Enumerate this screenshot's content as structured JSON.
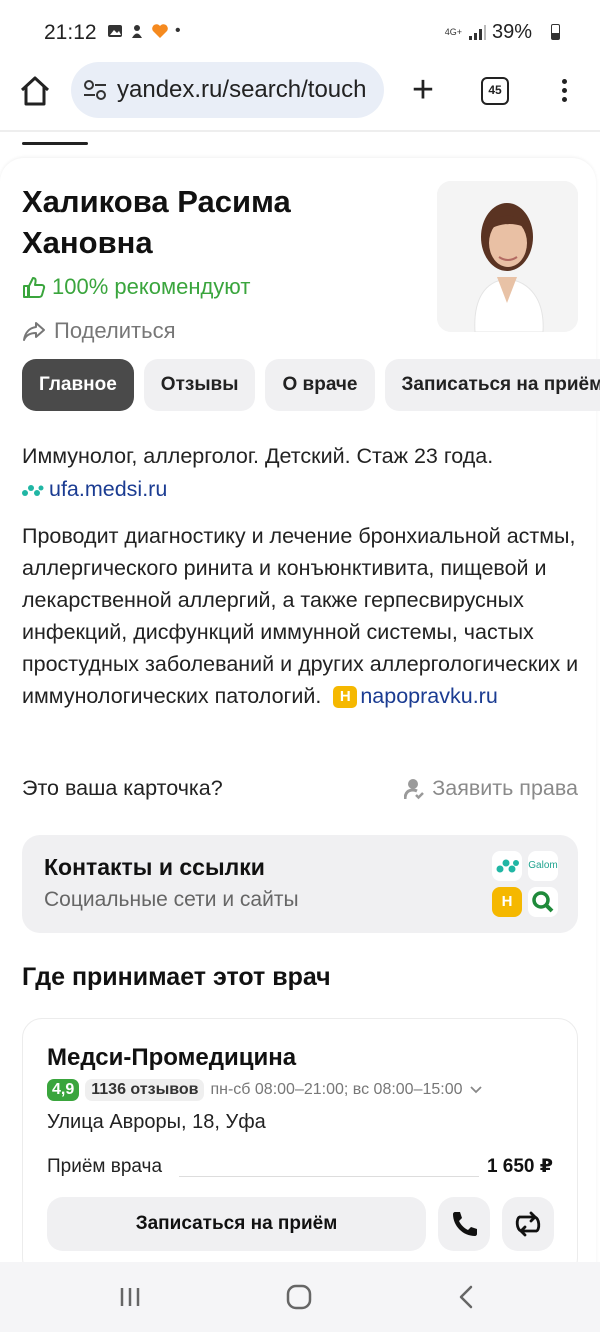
{
  "status_bar": {
    "time": "21:12",
    "network": "4G+",
    "battery": "39%",
    "notification_dot": "•"
  },
  "browser": {
    "url": "yandex.ru/search/touch",
    "tabs_count": "45"
  },
  "doctor": {
    "name": "Халикова Расима Хановна",
    "recommend": "100% рекомендуют",
    "share_label": "Поделиться"
  },
  "tabs": [
    {
      "label": "Главное",
      "active": true
    },
    {
      "label": "Отзывы",
      "active": false
    },
    {
      "label": "О враче",
      "active": false
    },
    {
      "label": "Записаться на приём",
      "active": false
    }
  ],
  "about": {
    "specialty": "Иммунолог, аллерголог. Детский. Стаж 23 года.",
    "source1": "ufa.medsi.ru",
    "description": "Проводит диагностику и лечение бронхиальной астмы, аллергического ринита и конъюнктивита, пищевой и лекарственной аллергий, а также герпесвирусных инфекций, дисфункций иммунной системы, частых простудных заболеваний и других аллергологических и иммунологических патологий.",
    "source2_badge": "Н",
    "source2": "napopravku.ru"
  },
  "claim": {
    "question": "Это ваша карточка?",
    "action": "Заявить права"
  },
  "contacts": {
    "title": "Контакты и ссылки",
    "subtitle": "Социальные сети и сайты",
    "icon_galom": "Galom",
    "icon_n": "Н"
  },
  "where": {
    "title": "Где принимает этот врач"
  },
  "clinic": {
    "name": "Медси-Промедицина",
    "rating": "4,9",
    "reviews": "1136 отзывов",
    "hours": "пн-сб 08:00–21:00; вс 08:00–15:00",
    "address": "Улица Авроры, 18, Уфа",
    "service": "Приём врача",
    "price": "1 650 ₽",
    "book_label": "Записаться на приём"
  },
  "colors": {
    "accent_green": "#3aa53d",
    "link_blue": "#1b3c92",
    "badge_yellow": "#f5b800"
  }
}
